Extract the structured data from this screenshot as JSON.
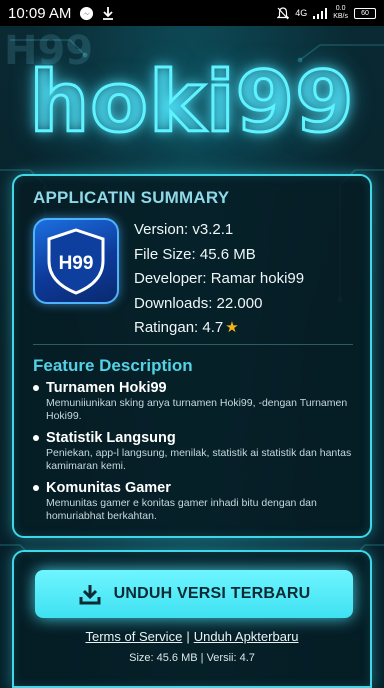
{
  "status_bar": {
    "time": "10:09 AM",
    "network": "4G",
    "data_rate_top": "0.0",
    "data_rate_unit": "KB/s",
    "battery": "60"
  },
  "header": {
    "logo_text": "hoki99",
    "ghost_text": "H99"
  },
  "summary": {
    "title": "APPLICATIN SUMMARY",
    "app_icon_text": "H99",
    "rows": [
      "Version: v3.2.1",
      "File Size: 45.6 MB",
      "Developer: Ramar hoki99",
      "Downloads: 22.000",
      "Ratingan: 4.7"
    ],
    "rating_icon": "star-icon"
  },
  "features": {
    "title": "Feature Description",
    "items": [
      {
        "name": "Turnamen Hoki99",
        "desc": "Memuniiunikan sking anya turnamen Hoki99, -dengan Turnamen Hoki99."
      },
      {
        "name": "Statistik Langsung",
        "desc": "Peniekan, app-l langsung, menilak, statistik ai statistik dan hantas kamimaran kemi."
      },
      {
        "name": "Komunitas Gamer",
        "desc": "Memunitas gamer e konitas gamer inhadi bitu dengan dan homuriabhat berkahtan."
      }
    ]
  },
  "download": {
    "button_label": "UNDUH VERSI TERBARU",
    "link_terms": "Terms of Service",
    "link_separator": "|",
    "link_apk": "Unduh Apk‍terbaru",
    "meta": "Size: 45.6 MB | Versii: 4.7"
  },
  "colors": {
    "accent": "#3fd8e8",
    "button": "#5eeefd",
    "star": "#f6b21b",
    "feature_title": "#52d2e6"
  }
}
